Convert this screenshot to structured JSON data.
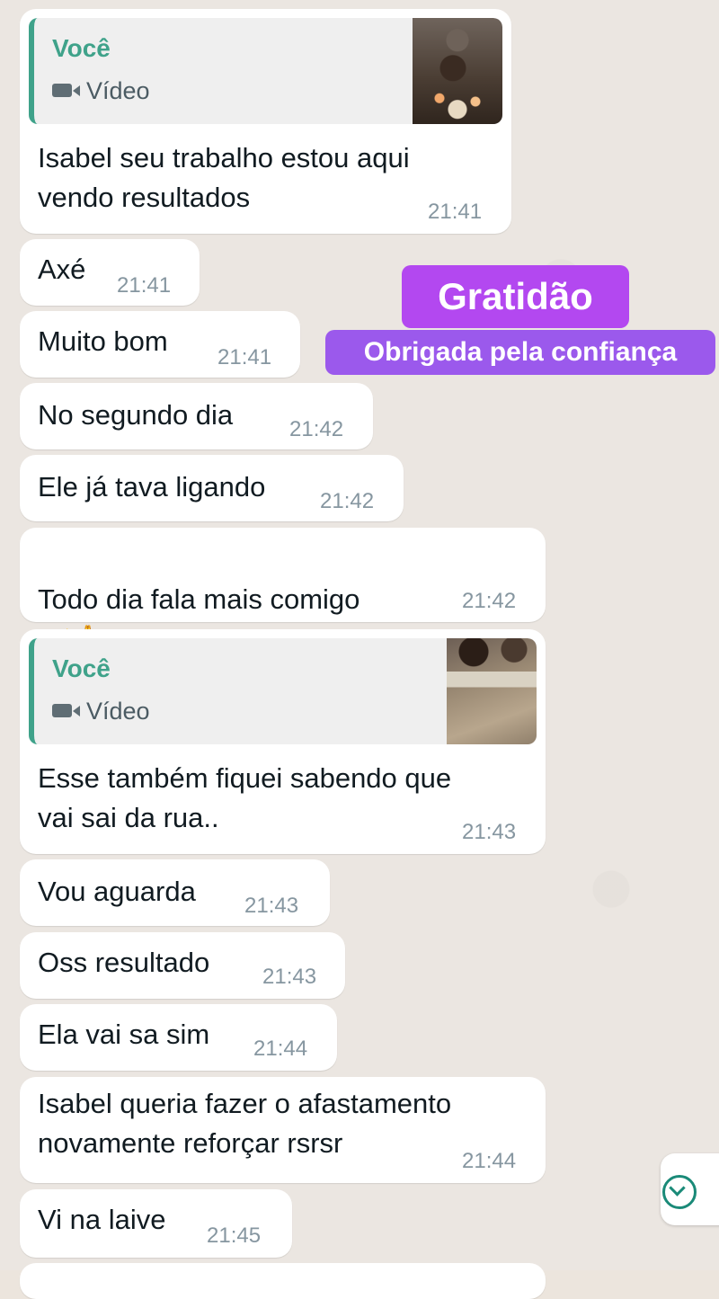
{
  "messages": [
    {
      "text": "Isabel seu trabalho estou aqui\nvendo resultados",
      "time": "21:41",
      "quote": {
        "author": "Você",
        "type": "Vídeo"
      }
    },
    {
      "text": "Axé",
      "time": "21:41"
    },
    {
      "text": "Muito bom",
      "time": "21:41"
    },
    {
      "text": "No segundo dia",
      "time": "21:42"
    },
    {
      "text": "Ele já tava ligando",
      "time": "21:42"
    },
    {
      "text": "Todo dia fala mais comigo",
      "emoji": "🤝🙏",
      "time": "21:42"
    },
    {
      "text": "Esse também fiquei sabendo que\nvai sai da rua..",
      "time": "21:43",
      "quote": {
        "author": "Você",
        "type": "Vídeo"
      }
    },
    {
      "text": "Vou aguarda",
      "time": "21:43"
    },
    {
      "text": "Oss resultado",
      "time": "21:43"
    },
    {
      "text": "Ela vai sa sim",
      "time": "21:44"
    },
    {
      "text": "Isabel queria fazer o afastamento\nnovamente reforçar rsrsr",
      "time": "21:44"
    },
    {
      "text": "Vi na laive",
      "time": "21:45"
    }
  ],
  "overlay": {
    "title": "Gratidão",
    "subtitle": "Obrigada pela confiança",
    "title_color": "#b348f0",
    "subtitle_color": "#9b59ec"
  },
  "colors": {
    "bubble": "#ffffff",
    "background": "#ebe6e1",
    "quote_accent": "#3fa28a",
    "timestamp": "#8696a0"
  },
  "icons": {
    "video": "video-camera-icon",
    "scroll": "chevron-down-circle-icon"
  }
}
